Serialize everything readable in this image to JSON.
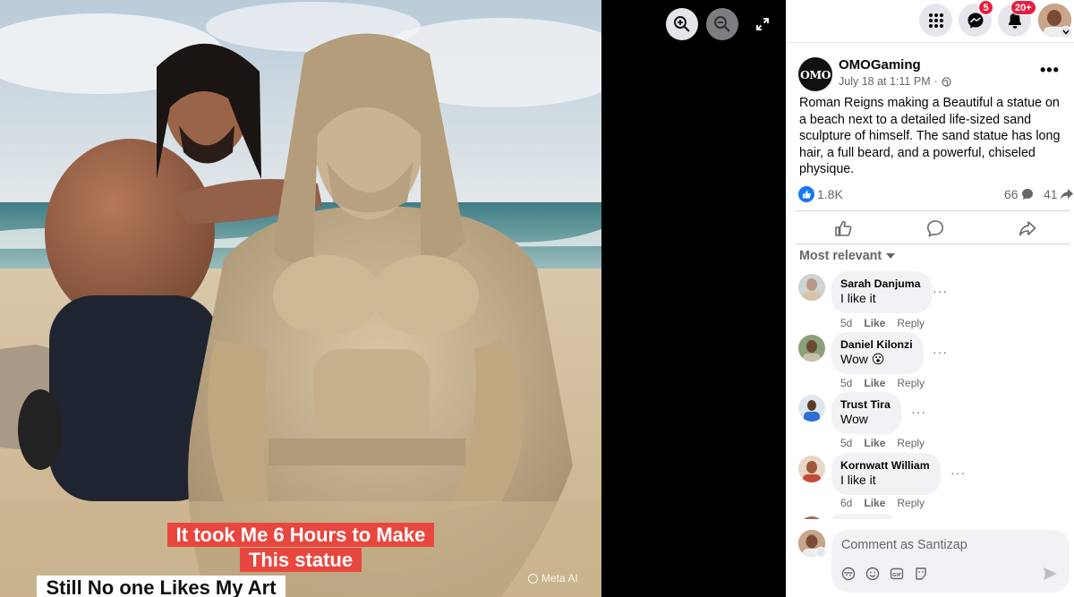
{
  "viewer": {
    "captions": {
      "line1": "It took Me 6 Hours to Make",
      "line2": "This statue",
      "line3": "Still No one Likes My Art"
    },
    "watermark": "Meta AI",
    "buttons": [
      "zoom-in-icon",
      "zoom-out-icon",
      "expand-icon"
    ]
  },
  "topbar": {
    "messenger_badge": "5",
    "notifications_badge": "20+"
  },
  "post": {
    "logo_text": "OMO",
    "author": "OMOGaming",
    "date": "July 18 at 1:11 PM",
    "separator": "·",
    "text": "Roman Reigns making a Beautiful a statue on a beach next to a detailed life-sized sand sculpture of himself. The sand statue has long hair, a full beard, and a powerful, chiseled physique.",
    "likes": "1.8K",
    "comments_count": "66",
    "shares_count": "41"
  },
  "comments_section": {
    "sort_label": "Most relevant",
    "like_label": "Like",
    "reply_label": "Reply",
    "items": [
      {
        "name": "Sarah Danjuma",
        "text": "I like it",
        "age": "5d"
      },
      {
        "name": "Daniel Kilonzi",
        "text": "Wow 😮",
        "age": "5d"
      },
      {
        "name": "Trust Tira",
        "text": "Wow",
        "age": "5d"
      },
      {
        "name": "Kornwatt William",
        "text": "I like it",
        "age": "6d"
      }
    ],
    "input_placeholder": "Comment as Santizap"
  },
  "colors": {
    "facebook_blue": "#1877f2",
    "badge_red": "#e41e3f",
    "caption_red": "#e8473f"
  }
}
